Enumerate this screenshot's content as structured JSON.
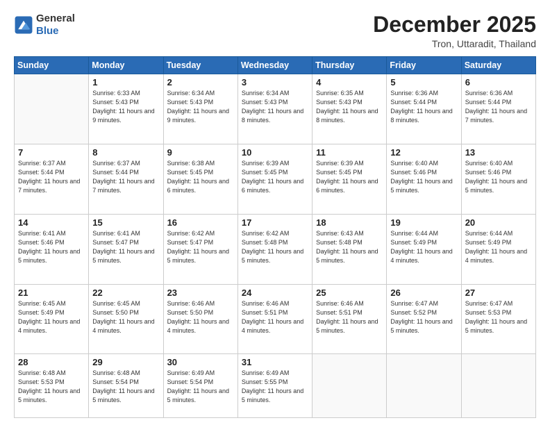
{
  "logo": {
    "general": "General",
    "blue": "Blue"
  },
  "header": {
    "month": "December 2025",
    "location": "Tron, Uttaradit, Thailand"
  },
  "days_of_week": [
    "Sunday",
    "Monday",
    "Tuesday",
    "Wednesday",
    "Thursday",
    "Friday",
    "Saturday"
  ],
  "weeks": [
    [
      {
        "day": "",
        "sunrise": "",
        "sunset": "",
        "daylight": "",
        "empty": true
      },
      {
        "day": "1",
        "sunrise": "6:33 AM",
        "sunset": "5:43 PM",
        "daylight": "11 hours and 9 minutes."
      },
      {
        "day": "2",
        "sunrise": "6:34 AM",
        "sunset": "5:43 PM",
        "daylight": "11 hours and 9 minutes."
      },
      {
        "day": "3",
        "sunrise": "6:34 AM",
        "sunset": "5:43 PM",
        "daylight": "11 hours and 8 minutes."
      },
      {
        "day": "4",
        "sunrise": "6:35 AM",
        "sunset": "5:43 PM",
        "daylight": "11 hours and 8 minutes."
      },
      {
        "day": "5",
        "sunrise": "6:36 AM",
        "sunset": "5:44 PM",
        "daylight": "11 hours and 8 minutes."
      },
      {
        "day": "6",
        "sunrise": "6:36 AM",
        "sunset": "5:44 PM",
        "daylight": "11 hours and 7 minutes."
      }
    ],
    [
      {
        "day": "7",
        "sunrise": "6:37 AM",
        "sunset": "5:44 PM",
        "daylight": "11 hours and 7 minutes."
      },
      {
        "day": "8",
        "sunrise": "6:37 AM",
        "sunset": "5:44 PM",
        "daylight": "11 hours and 7 minutes."
      },
      {
        "day": "9",
        "sunrise": "6:38 AM",
        "sunset": "5:45 PM",
        "daylight": "11 hours and 6 minutes."
      },
      {
        "day": "10",
        "sunrise": "6:39 AM",
        "sunset": "5:45 PM",
        "daylight": "11 hours and 6 minutes."
      },
      {
        "day": "11",
        "sunrise": "6:39 AM",
        "sunset": "5:45 PM",
        "daylight": "11 hours and 6 minutes."
      },
      {
        "day": "12",
        "sunrise": "6:40 AM",
        "sunset": "5:46 PM",
        "daylight": "11 hours and 5 minutes."
      },
      {
        "day": "13",
        "sunrise": "6:40 AM",
        "sunset": "5:46 PM",
        "daylight": "11 hours and 5 minutes."
      }
    ],
    [
      {
        "day": "14",
        "sunrise": "6:41 AM",
        "sunset": "5:46 PM",
        "daylight": "11 hours and 5 minutes."
      },
      {
        "day": "15",
        "sunrise": "6:41 AM",
        "sunset": "5:47 PM",
        "daylight": "11 hours and 5 minutes."
      },
      {
        "day": "16",
        "sunrise": "6:42 AM",
        "sunset": "5:47 PM",
        "daylight": "11 hours and 5 minutes."
      },
      {
        "day": "17",
        "sunrise": "6:42 AM",
        "sunset": "5:48 PM",
        "daylight": "11 hours and 5 minutes."
      },
      {
        "day": "18",
        "sunrise": "6:43 AM",
        "sunset": "5:48 PM",
        "daylight": "11 hours and 5 minutes."
      },
      {
        "day": "19",
        "sunrise": "6:44 AM",
        "sunset": "5:49 PM",
        "daylight": "11 hours and 4 minutes."
      },
      {
        "day": "20",
        "sunrise": "6:44 AM",
        "sunset": "5:49 PM",
        "daylight": "11 hours and 4 minutes."
      }
    ],
    [
      {
        "day": "21",
        "sunrise": "6:45 AM",
        "sunset": "5:49 PM",
        "daylight": "11 hours and 4 minutes."
      },
      {
        "day": "22",
        "sunrise": "6:45 AM",
        "sunset": "5:50 PM",
        "daylight": "11 hours and 4 minutes."
      },
      {
        "day": "23",
        "sunrise": "6:46 AM",
        "sunset": "5:50 PM",
        "daylight": "11 hours and 4 minutes."
      },
      {
        "day": "24",
        "sunrise": "6:46 AM",
        "sunset": "5:51 PM",
        "daylight": "11 hours and 4 minutes."
      },
      {
        "day": "25",
        "sunrise": "6:46 AM",
        "sunset": "5:51 PM",
        "daylight": "11 hours and 5 minutes."
      },
      {
        "day": "26",
        "sunrise": "6:47 AM",
        "sunset": "5:52 PM",
        "daylight": "11 hours and 5 minutes."
      },
      {
        "day": "27",
        "sunrise": "6:47 AM",
        "sunset": "5:53 PM",
        "daylight": "11 hours and 5 minutes."
      }
    ],
    [
      {
        "day": "28",
        "sunrise": "6:48 AM",
        "sunset": "5:53 PM",
        "daylight": "11 hours and 5 minutes."
      },
      {
        "day": "29",
        "sunrise": "6:48 AM",
        "sunset": "5:54 PM",
        "daylight": "11 hours and 5 minutes."
      },
      {
        "day": "30",
        "sunrise": "6:49 AM",
        "sunset": "5:54 PM",
        "daylight": "11 hours and 5 minutes."
      },
      {
        "day": "31",
        "sunrise": "6:49 AM",
        "sunset": "5:55 PM",
        "daylight": "11 hours and 5 minutes."
      },
      {
        "day": "",
        "sunrise": "",
        "sunset": "",
        "daylight": "",
        "empty": true
      },
      {
        "day": "",
        "sunrise": "",
        "sunset": "",
        "daylight": "",
        "empty": true
      },
      {
        "day": "",
        "sunrise": "",
        "sunset": "",
        "daylight": "",
        "empty": true
      }
    ]
  ],
  "labels": {
    "sunrise": "Sunrise:",
    "sunset": "Sunset:",
    "daylight": "Daylight:"
  }
}
